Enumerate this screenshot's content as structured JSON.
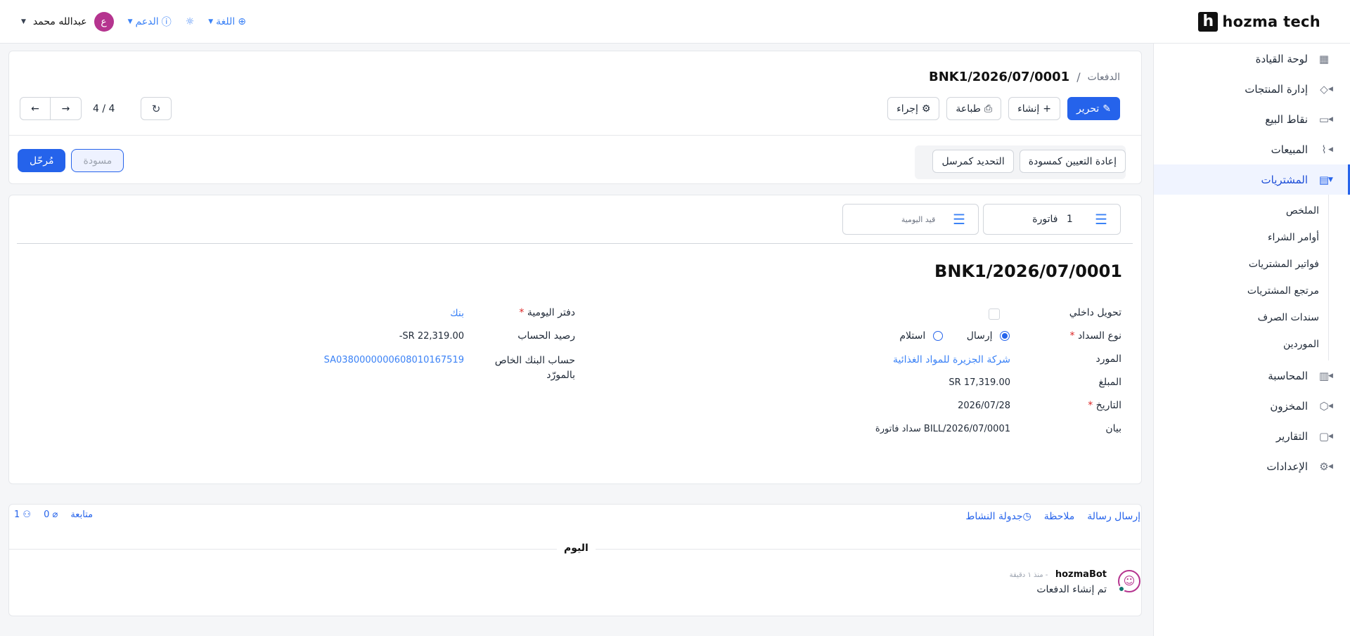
{
  "brand": {
    "logo_letter": "h",
    "name": "hozma tech"
  },
  "topbar": {
    "user_initial": "ع",
    "user_name": "عبدالله محمد",
    "support": "الدعم",
    "language": "اللغة"
  },
  "sidebar": {
    "items": [
      {
        "label": "لوحة القيادة",
        "icon": "grid-icon"
      },
      {
        "label": "إدارة المنتجات",
        "icon": "tag-icon"
      },
      {
        "label": "نقاط البيع",
        "icon": "store-icon"
      },
      {
        "label": "المبيعات",
        "icon": "chart-line-icon"
      },
      {
        "label": "المشتريات",
        "icon": "card-icon"
      },
      {
        "label": "المحاسبة",
        "icon": "ledger-icon"
      },
      {
        "label": "المخزون",
        "icon": "box-icon"
      },
      {
        "label": "التقارير",
        "icon": "report-icon"
      },
      {
        "label": "الإعدادات",
        "icon": "gear-icon"
      }
    ],
    "purchases_sub": [
      "الملخص",
      "أوامر الشراء",
      "فواتير المشتريات",
      "مرتجع المشتريات",
      "سندات الصرف",
      "الموردين"
    ]
  },
  "breadcrumb": {
    "parent": "الدفعات",
    "current": "BNK1/2026/07/0001"
  },
  "toolbar": {
    "edit": "تحرير",
    "create": "إنشاء",
    "print": "طباعة",
    "action": "إجراء"
  },
  "pager": {
    "text": "4 / 4"
  },
  "actions": {
    "reset_draft": "إعادة التعيين كمسودة",
    "mark_sent": "التحديد كمرسل"
  },
  "states": {
    "draft": "مسودة",
    "posted": "مُرحّل"
  },
  "smart_buttons": {
    "invoice_count": "1",
    "invoice_label": "فاتورة",
    "journal_label": "قيد اليومية"
  },
  "document": {
    "title": "BNK1/2026/07/0001",
    "internal_transfer_label": "تحويل داخلي",
    "payment_type_label": "نوع السداد",
    "payment_send": "إرسال",
    "payment_receive": "استلام",
    "vendor_label": "المورد",
    "vendor_value": "شركة الجزيرة للمواد الغذائية",
    "amount_label": "المبلغ",
    "amount_value": "SR 17,319.00",
    "date_label": "التاريخ",
    "date_value": "2026/07/28",
    "memo_label": "بيان",
    "memo_value": "سداد فاتورة BILL/2026/07/0001",
    "journal_label": "دفتر اليومية",
    "journal_value": "بنك",
    "balance_label": "رصيد الحساب",
    "balance_value": "-SR 22,319.00",
    "bank_account_label_1": "حساب البنك الخاص",
    "bank_account_label_2": "بالمورّد",
    "bank_account_value": "SA0380000000608010167519",
    "required_mark": "*"
  },
  "chatter": {
    "send_message": "إرسال رسالة",
    "note": "ملاحظة",
    "schedule": "جدولة النشاط",
    "follow": "متابعة",
    "attachments_count": "0",
    "followers_count": "1",
    "today": "اليوم",
    "author": "hozmaBot",
    "time": "- منذ ١ دقيقة",
    "body": "تم إنشاء الدفعات"
  },
  "colors": {
    "primary": "#2563eb",
    "avatar": "#b5348f"
  }
}
